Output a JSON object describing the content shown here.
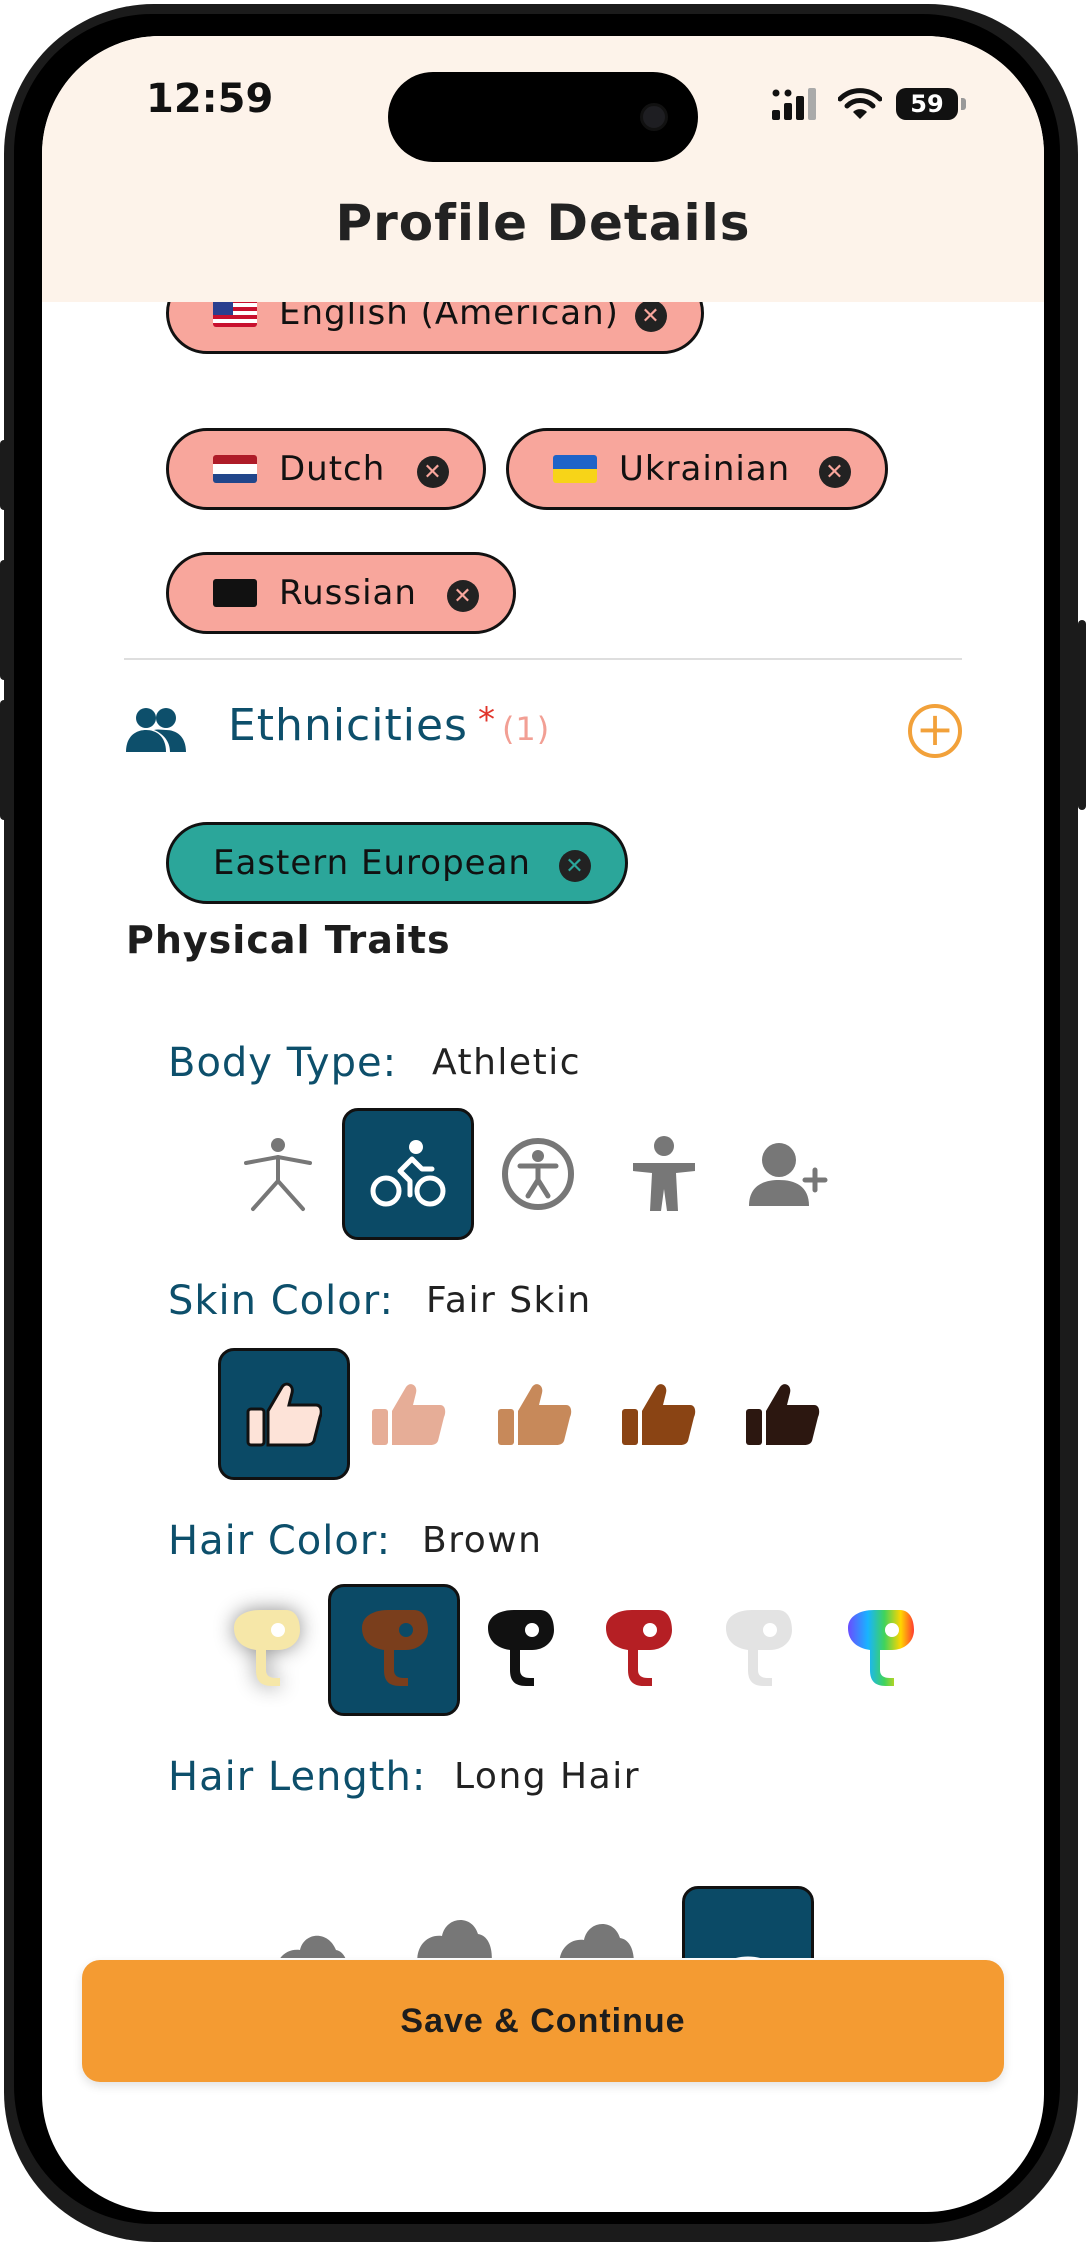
{
  "status_bar": {
    "time": "12:59",
    "battery": "59"
  },
  "header": {
    "title": "Profile Details"
  },
  "languages": [
    {
      "label": "English (American)",
      "flag": "us"
    },
    {
      "label": "Dutch",
      "flag": "nl"
    },
    {
      "label": "Ukrainian",
      "flag": "ua"
    },
    {
      "label": "Russian",
      "flag": "black"
    }
  ],
  "ethnicities": {
    "label": "Ethnicities",
    "required_mark": "*",
    "count": "(1)",
    "items": [
      {
        "label": "Eastern European"
      }
    ]
  },
  "physical_traits": {
    "title": "Physical Traits",
    "body_type": {
      "label": "Body Type:",
      "value": "Athletic",
      "options": [
        "slim-figure-icon",
        "cyclist-icon",
        "accessibility-figure-icon",
        "solid-figure-icon",
        "add-user-icon"
      ],
      "selected_index": 1
    },
    "skin_color": {
      "label": "Skin Color:",
      "value": "Fair Skin",
      "options": [
        "#fde3d8",
        "#e6ad97",
        "#c7895a",
        "#8a4414",
        "#2c1710"
      ],
      "selected_index": 0
    },
    "hair_color": {
      "label": "Hair Color:",
      "value": "Brown",
      "options": [
        "#f6e7a8",
        "#7a3e1c",
        "#111111",
        "#b51f24",
        "#e3e3e3",
        "rainbow"
      ],
      "selected_index": 1
    },
    "hair_length": {
      "label": "Hair Length:",
      "value": "Long Hair",
      "selected_index": 3
    }
  },
  "footer": {
    "save_label": "Save & Continue"
  },
  "colors": {
    "accent": "#f49b32",
    "chip_language": "#f8a69c",
    "chip_ethnicity": "#2ba69a",
    "selected_tile": "#0b4a66",
    "label_teal": "#0d4f6b",
    "header_bg": "#fdf3ea"
  }
}
